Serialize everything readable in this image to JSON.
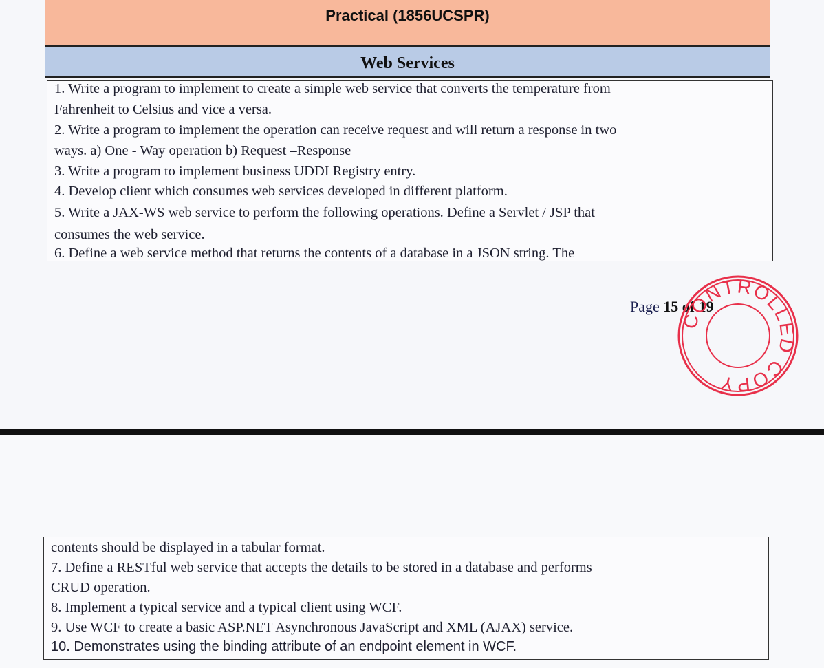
{
  "header": {
    "title": "Practical (1856UCSPR)",
    "section": "Web Services"
  },
  "page1_lines": [
    "1. Write a program to implement to create a simple web service that converts the temperature from",
    "Fahrenheit to Celsius and vice a versa.",
    "2. Write a program to implement the operation can receive request and will return a response in two",
    "ways. a) One - Way operation b) Request –Response",
    "3. Write a program to implement business UDDI Registry entry.",
    "4. Develop client which consumes web services developed in different platform.",
    "5. Write a JAX-WS web service to perform the following operations. Define a Servlet / JSP that",
    "consumes the web service.",
    "6. Define a web service method that returns the contents of a database in a JSON string. The"
  ],
  "footer": {
    "page_label": "Page",
    "page_current": "15",
    "page_of": "of",
    "page_total": "19"
  },
  "stamp": {
    "text": "CONTROLLED COPY",
    "color": "#e8304a"
  },
  "page2_lines": [
    "contents should be displayed in a tabular format.",
    "7. Define a RESTful web service that accepts the details to be stored in a database and performs",
    "CRUD operation.",
    "8. Implement a typical service and a typical client using WCF.",
    "9. Use WCF to create a basic ASP.NET Asynchronous JavaScript and XML (AJAX) service.",
    "10. Demonstrates using the binding attribute of an endpoint element in WCF."
  ]
}
